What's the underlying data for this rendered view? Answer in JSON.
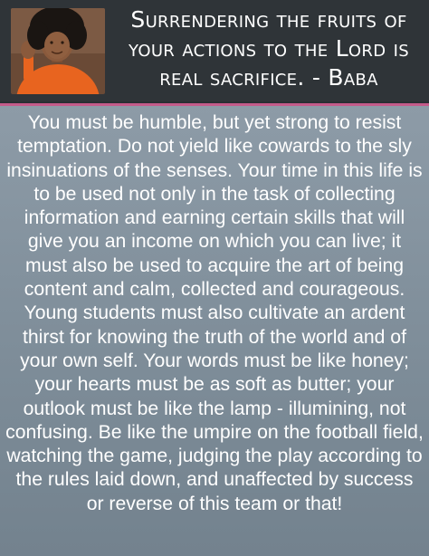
{
  "header": {
    "quote": "Surrendering the fruits of your actions to the Lord is real sacrifice. - Baba"
  },
  "body": {
    "message": "You must be humble, but yet strong to resist temptation. Do not yield like cowards to the sly insinuations of the senses. Your time in this life is to be used not only in the task of collecting information and earning certain skills that will give you an income on which you can live; it must also be used to acquire the art of being content and calm, collected and courageous. Young students must also cultivate an ardent thirst for knowing the truth of the world and of your own self. Your words must be like honey; your hearts must be as soft as butter; your outlook must be like the lamp - illumining, not confusing. Be like the umpire on the football field, watching the game, judging the play according to the rules laid down, and unaffected by success or reverse of this team or that!"
  },
  "colors": {
    "header_bg": "#2f3438",
    "panel_bg": "#8d9ba7",
    "accent_border": "#c45b8a",
    "robe": "#e8641f",
    "text": "#ffffff"
  }
}
